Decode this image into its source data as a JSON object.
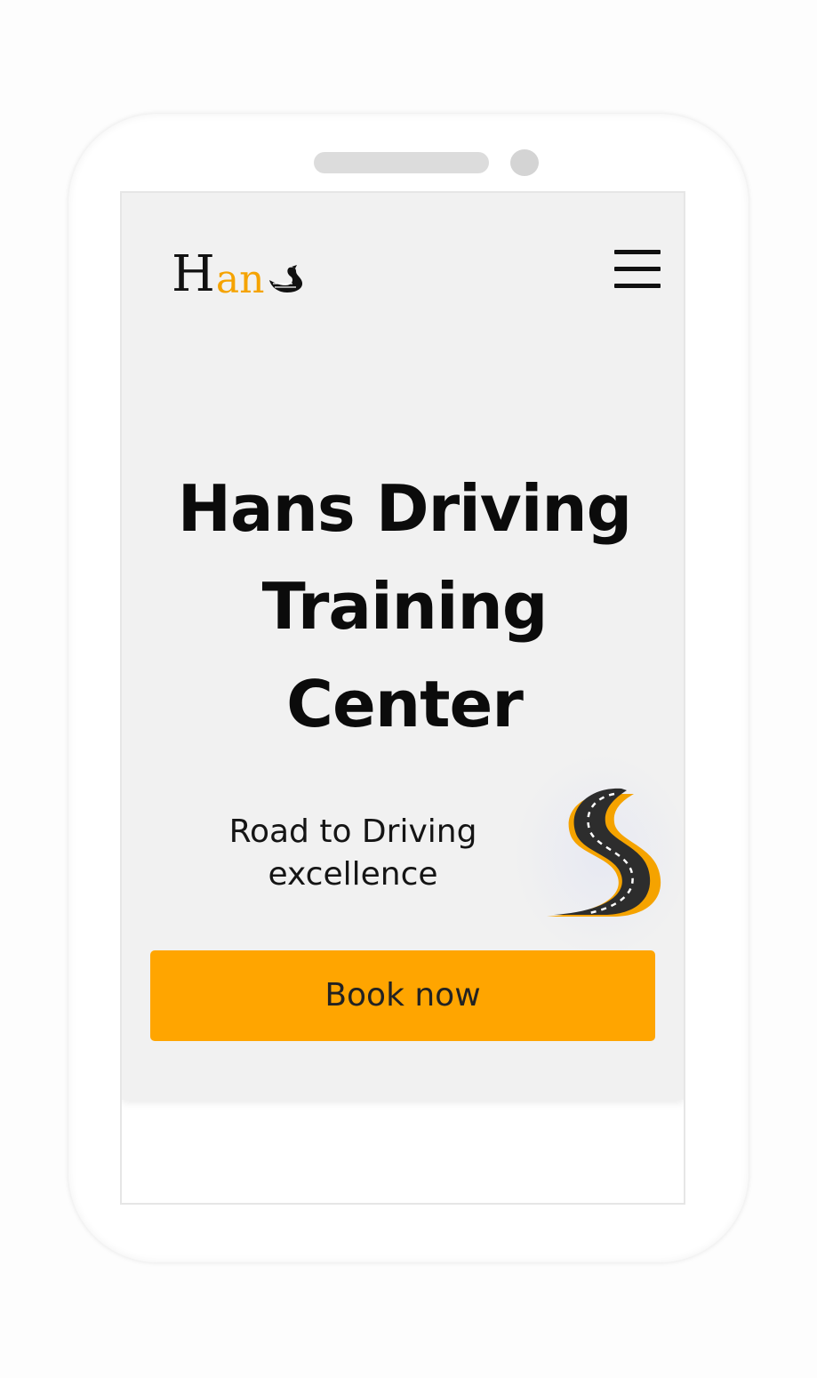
{
  "brand": {
    "logo_initial": "H",
    "logo_rest": "an",
    "logo_icon": "swan-icon"
  },
  "nav": {
    "menu_icon": "hamburger-menu-icon"
  },
  "hero": {
    "title": "Hans Driving Training Center",
    "tagline": "Road to Driving excellence",
    "illustration": "winding-road-icon",
    "cta_label": "Book now"
  },
  "colors": {
    "accent": "#ffa500",
    "hero_background": "#f1f1f1",
    "text": "#0b0b0b",
    "device_frame": "#ffffff"
  }
}
